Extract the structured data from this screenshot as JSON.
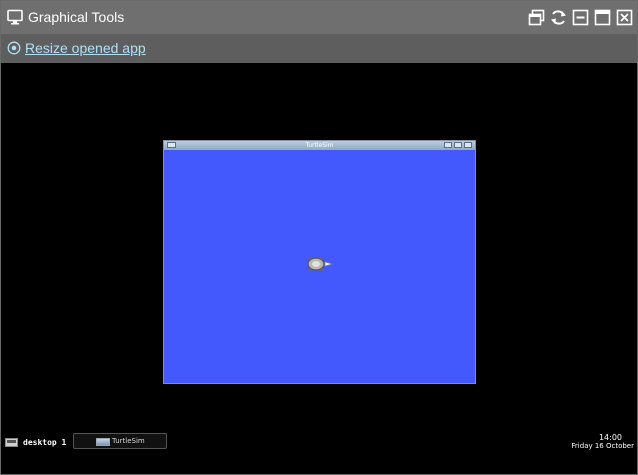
{
  "window": {
    "title": "Graphical Tools"
  },
  "toolbar": {
    "resize_link": "Resize opened app"
  },
  "title_controls": [
    "restore-icon",
    "refresh-icon",
    "minimize-icon",
    "maximize-icon",
    "close-icon"
  ],
  "remote_desktop": {
    "app_window": {
      "title": "TurtleSim",
      "background": "#4359fd"
    },
    "taskbar": {
      "desktop_label": "desktop 1",
      "task_label": "TurtleSim",
      "clock_time": "14:00",
      "clock_date": "Friday 16 October"
    }
  },
  "colors": {
    "titlebar": "#6f6f6f",
    "link": "#aee0f4",
    "desktop": "#000000"
  }
}
